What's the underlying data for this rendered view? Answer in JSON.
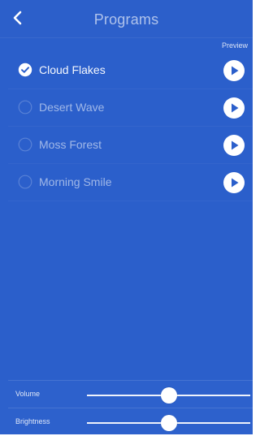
{
  "header": {
    "title": "Programs",
    "back_icon": "chevron-left-icon"
  },
  "list": {
    "preview_label": "Preview",
    "programs": [
      {
        "label": "Cloud Flakes",
        "selected": true
      },
      {
        "label": "Desert Wave",
        "selected": false
      },
      {
        "label": "Moss Forest",
        "selected": false
      },
      {
        "label": "Morning Smile",
        "selected": false
      }
    ]
  },
  "controls": {
    "volume": {
      "label": "Volume",
      "value": 0.5
    },
    "brightness": {
      "label": "Brightness",
      "value": 0.5
    }
  },
  "colors": {
    "background": "#2b5fcb",
    "text": "#ffffff"
  }
}
